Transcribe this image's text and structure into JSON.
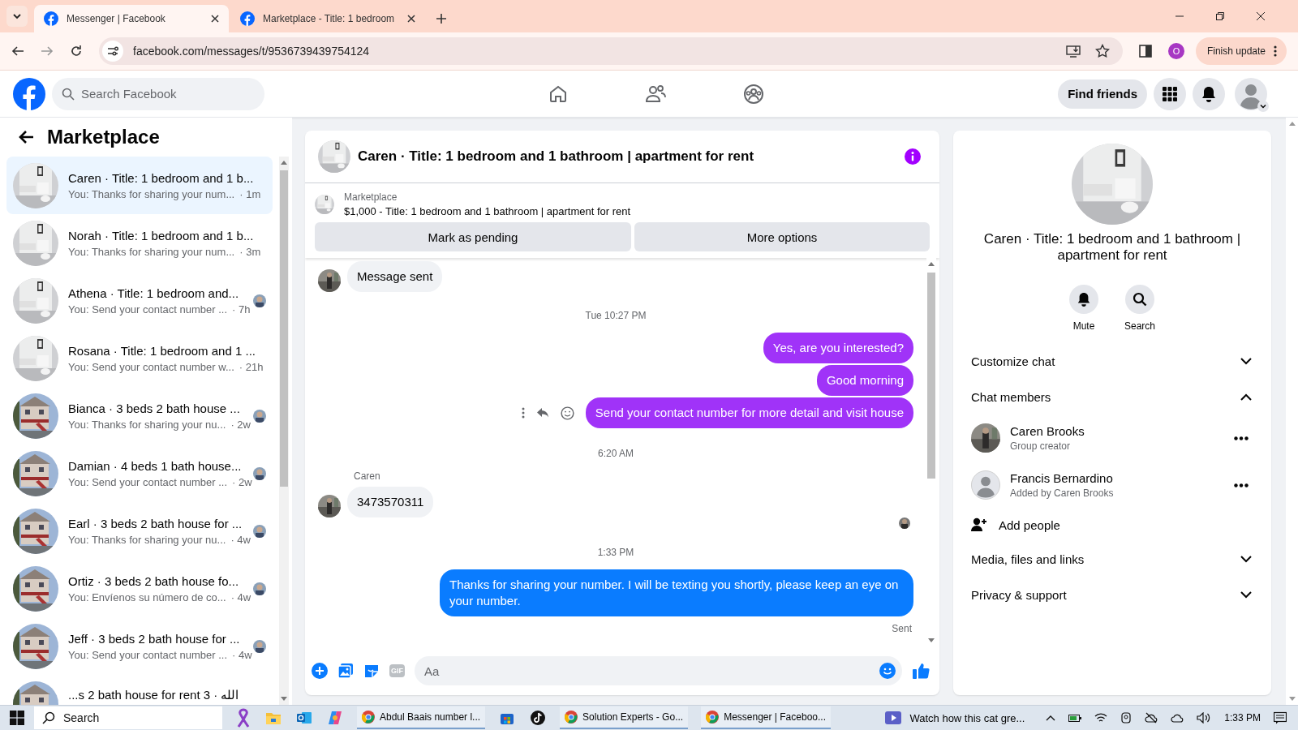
{
  "browser": {
    "tabs": [
      {
        "title": "Messenger | Facebook",
        "selected": true
      },
      {
        "title": "Marketplace - Title: 1 bedroom",
        "selected": false
      }
    ],
    "url": "facebook.com/messages/t/9536739439754124",
    "profile_initial": "O",
    "update_button": "Finish update"
  },
  "header": {
    "search_placeholder": "Search Facebook",
    "find_friends": "Find friends"
  },
  "sidebar": {
    "title": "Marketplace",
    "conversations": [
      {
        "title": "Caren · Title: 1 bedroom and 1 b...",
        "preview": "You: Thanks for sharing your num...",
        "time": "· 1m",
        "selected": true,
        "seen": false
      },
      {
        "title": "Norah · Title: 1 bedroom and 1 b...",
        "preview": "You: Thanks for sharing your num...",
        "time": "· 3m",
        "selected": false,
        "seen": false
      },
      {
        "title": "Athena · Title: 1 bedroom and...",
        "preview": "You: Send your contact number ...",
        "time": "· 7h",
        "selected": false,
        "seen": true
      },
      {
        "title": "Rosana · Title: 1 bedroom and 1 ...",
        "preview": "You: Send your contact number w...",
        "time": "· 21h",
        "selected": false,
        "seen": false
      },
      {
        "title": "Bianca · 3 beds 2 bath house ...",
        "preview": "You: Thanks for sharing your nu...",
        "time": "· 2w",
        "selected": false,
        "seen": true
      },
      {
        "title": "Damian · 4 beds 1 bath house...",
        "preview": "You: Send your contact number ...",
        "time": "· 2w",
        "selected": false,
        "seen": true
      },
      {
        "title": "Earl · 3 beds 2 bath house for ...",
        "preview": "You: Thanks for sharing your nu...",
        "time": "· 4w",
        "selected": false,
        "seen": true
      },
      {
        "title": "Ortiz · 3 beds 2 bath house fo...",
        "preview": "You: Envíenos su número de co...",
        "time": "· 4w",
        "selected": false,
        "seen": true
      },
      {
        "title": "Jeff · 3 beds 2 bath house for ...",
        "preview": "You: Send your contact number ...",
        "time": "· 4w",
        "selected": false,
        "seen": true
      },
      {
        "title": "...s 2 bath house for rent 3 · الله",
        "selected": false,
        "seen": false
      }
    ]
  },
  "chat": {
    "title": "Caren · Title: 1 bedroom and 1 bathroom | apartment for rent",
    "listing": {
      "label": "Marketplace",
      "text": "$1,000 - Title: 1 bedroom and 1 bathroom | apartment for rent",
      "buttons": [
        "Mark as pending",
        "More options"
      ]
    },
    "messages": [
      {
        "kind": "incoming",
        "text": "Message sent"
      },
      {
        "kind": "timestamp",
        "text": "Tue 10:27 PM"
      },
      {
        "kind": "outgoing",
        "text": "Yes, are you interested?",
        "color": "#a033f8",
        "actions": false
      },
      {
        "kind": "outgoing",
        "text": "Good morning",
        "color": "#a033f8",
        "actions": false
      },
      {
        "kind": "outgoing",
        "text": "Send your contact number for more detail and visit house",
        "color": "#a033f8",
        "actions": true
      },
      {
        "kind": "timestamp",
        "text": "6:20 AM"
      },
      {
        "kind": "incoming",
        "sender": "Caren",
        "text": "3473570311"
      },
      {
        "kind": "seen"
      },
      {
        "kind": "timestamp",
        "text": "1:33 PM"
      },
      {
        "kind": "outgoing",
        "text": "Thanks for sharing your number. I will be texting you shortly, please keep an eye on your number.",
        "color": "#0a7cff",
        "actions": false,
        "status": "Sent"
      }
    ],
    "composer": {
      "placeholder": "Aa",
      "gif_label": "GIF"
    }
  },
  "details": {
    "title": "Caren · Title: 1 bedroom and 1 bathroom | apartment for rent",
    "actions": [
      {
        "kind": "mute",
        "label": "Mute"
      },
      {
        "kind": "search",
        "label": "Search"
      }
    ],
    "sections": [
      {
        "label": "Customize chat",
        "expanded": false
      },
      {
        "label": "Chat members",
        "expanded": true,
        "members": [
          {
            "name": "Caren Brooks",
            "role": "Group creator"
          },
          {
            "name": "Francis Bernardino",
            "role": "Added by Caren Brooks",
            "kind": "default"
          }
        ],
        "add_label": "Add people"
      },
      {
        "label": "Media, files and links",
        "expanded": false
      },
      {
        "label": "Privacy & support",
        "expanded": false
      }
    ]
  },
  "taskbar": {
    "search_placeholder": "Search",
    "apps": [
      {
        "kind": "ribbon"
      },
      {
        "kind": "folder"
      },
      {
        "kind": "outlook"
      },
      {
        "kind": "copilot"
      },
      {
        "kind": "window",
        "label": "Abdul Baais number l..."
      },
      {
        "kind": "store"
      },
      {
        "kind": "tiktok"
      },
      {
        "kind": "window",
        "label": "Solution Experts - Go..."
      },
      {
        "kind": "window",
        "label": "Messenger | Faceboo..."
      }
    ],
    "news": "Watch how this cat gre...",
    "time": "1:33 PM"
  }
}
